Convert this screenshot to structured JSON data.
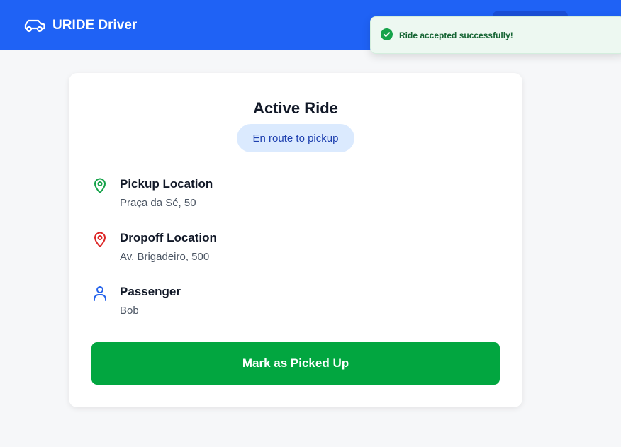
{
  "header": {
    "brand": "URIDE Driver",
    "brand_icon": "car-icon",
    "accent": "#1f62f5"
  },
  "toast": {
    "message": "Ride accepted successfully!",
    "icon": "check-circle-icon",
    "color": "#166534"
  },
  "ride": {
    "title": "Active Ride",
    "status": "En route to pickup",
    "pickup": {
      "label": "Pickup Location",
      "value": "Praça da Sé, 50",
      "icon": "map-pin-icon",
      "color": "#16a34a"
    },
    "dropoff": {
      "label": "Dropoff Location",
      "value": "Av. Brigadeiro, 500",
      "icon": "map-pin-icon",
      "color": "#dc2626"
    },
    "passenger": {
      "label": "Passenger",
      "value": "Bob",
      "icon": "user-icon",
      "color": "#2563eb"
    },
    "action_label": "Mark as Picked Up",
    "action_color": "#02a640"
  }
}
